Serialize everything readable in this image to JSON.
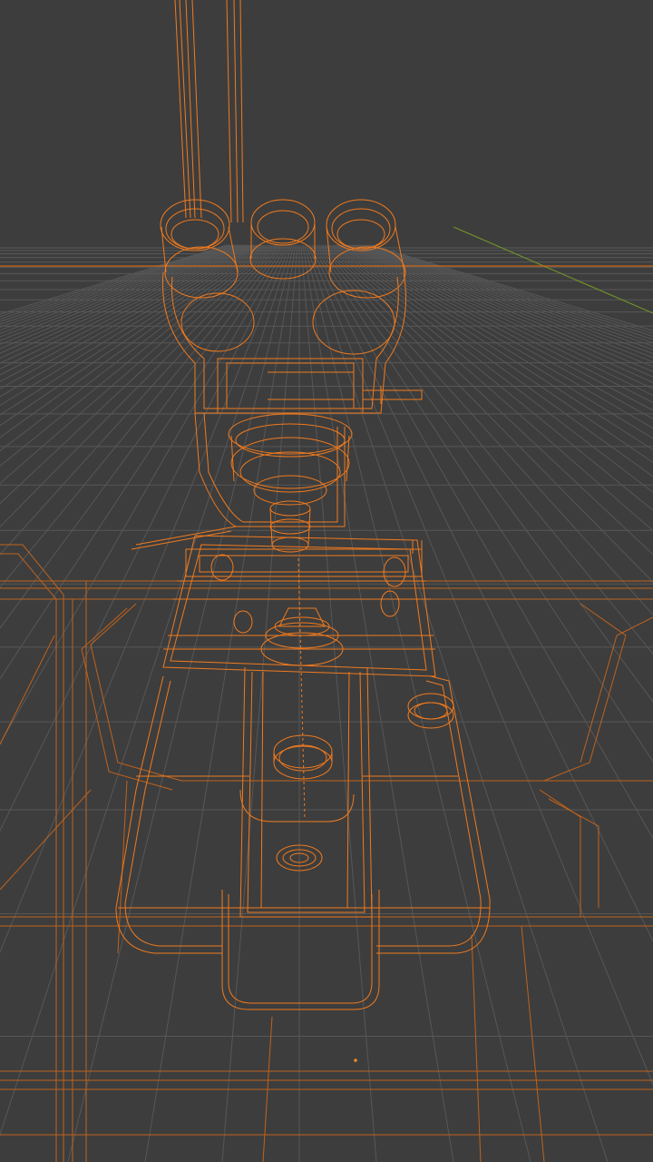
{
  "viewport": {
    "mode": "wireframe",
    "object": "microscope",
    "colors": {
      "background": "#3d3d3d",
      "grid": "#575757",
      "grid_bright": "#6a6a6a",
      "wire": "#f07a1e",
      "wire_dim": "#b85a14",
      "axis_y": "#6f8f2a",
      "origin": "#f08a2a"
    }
  }
}
